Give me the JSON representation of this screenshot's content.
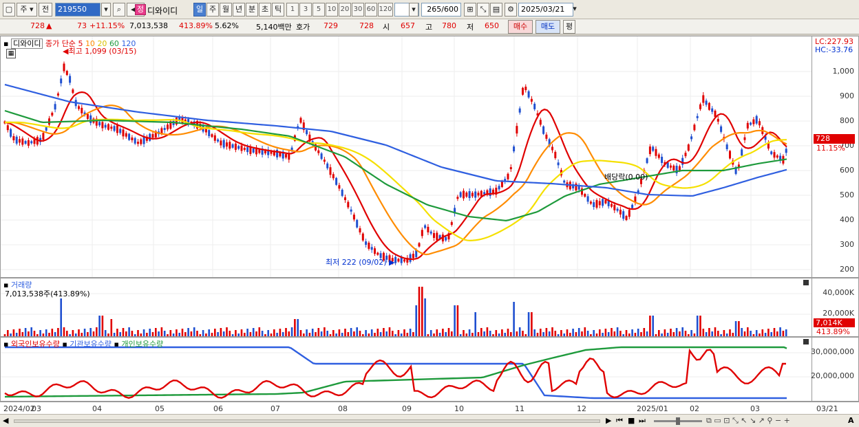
{
  "toolbar": {
    "type_label": "주",
    "prev_label": "전",
    "code": "219550",
    "stock_badge": "정",
    "stock_name": "디와이디",
    "periods": [
      "일",
      "주",
      "월",
      "년",
      "분",
      "초",
      "틱"
    ],
    "active_period": "일",
    "intervals": [
      "1",
      "3",
      "5",
      "10",
      "20",
      "30",
      "60",
      "120"
    ],
    "count": "265",
    "count_max": "/600",
    "date": "2025/03/21"
  },
  "quote": {
    "price": "728",
    "change_arrow": "▲",
    "change": "73",
    "change_pct": "+11.15%",
    "volume": "7,013,538",
    "volume_ratio": "413.89%",
    "turnover_pct": "5.62%",
    "trade_value": "5,140백만",
    "bid_label": "호가",
    "ask": "729",
    "bid": "728",
    "open_label": "시",
    "open": "657",
    "high_label": "고",
    "high": "780",
    "low_label": "저",
    "low": "650",
    "buy_label": "매수",
    "sell_label": "매도",
    "avg_label": "평"
  },
  "price_panel": {
    "legend_name": "디와이디",
    "legend_ma_title": "종가 단순",
    "ma_periods": [
      "5",
      "10",
      "20",
      "60",
      "120"
    ],
    "ma_colors": [
      "#e00000",
      "#ff8c00",
      "#f5e000",
      "#1e9a3c",
      "#2f5fe0"
    ],
    "max_note": "최고 1,099 (03/15)",
    "min_note": "최저 222 (09/02)",
    "dividend_note": "배당락(0.00)",
    "lc": "LC:227.93",
    "hc": "HC:-33.76",
    "current_tag": "728",
    "current_pct": "11.15%",
    "y_ticks": [
      "1,000",
      "900",
      "800",
      "700",
      "600",
      "500",
      "400",
      "300",
      "200"
    ]
  },
  "volume_panel": {
    "title": "거래량",
    "value": "7,013,538주(413.89%)",
    "y_ticks": [
      "40,000K",
      "20,000K"
    ],
    "tag": "7,014K",
    "tag_pct": "413.89%"
  },
  "holdings_panel": {
    "legend": [
      "외국인보유수량",
      "기관보유수량",
      "개인보유수량"
    ],
    "colors": [
      "#e00000",
      "#2f5fe0",
      "#1e9a3c"
    ],
    "y_ticks": [
      "30,000,000",
      "20,000,000"
    ]
  },
  "x_axis": [
    "2024/02",
    "03",
    "04",
    "05",
    "06",
    "07",
    "08",
    "09",
    "10",
    "11",
    "12",
    "2025/01",
    "02",
    "03"
  ],
  "x_axis_right": "03/21"
}
